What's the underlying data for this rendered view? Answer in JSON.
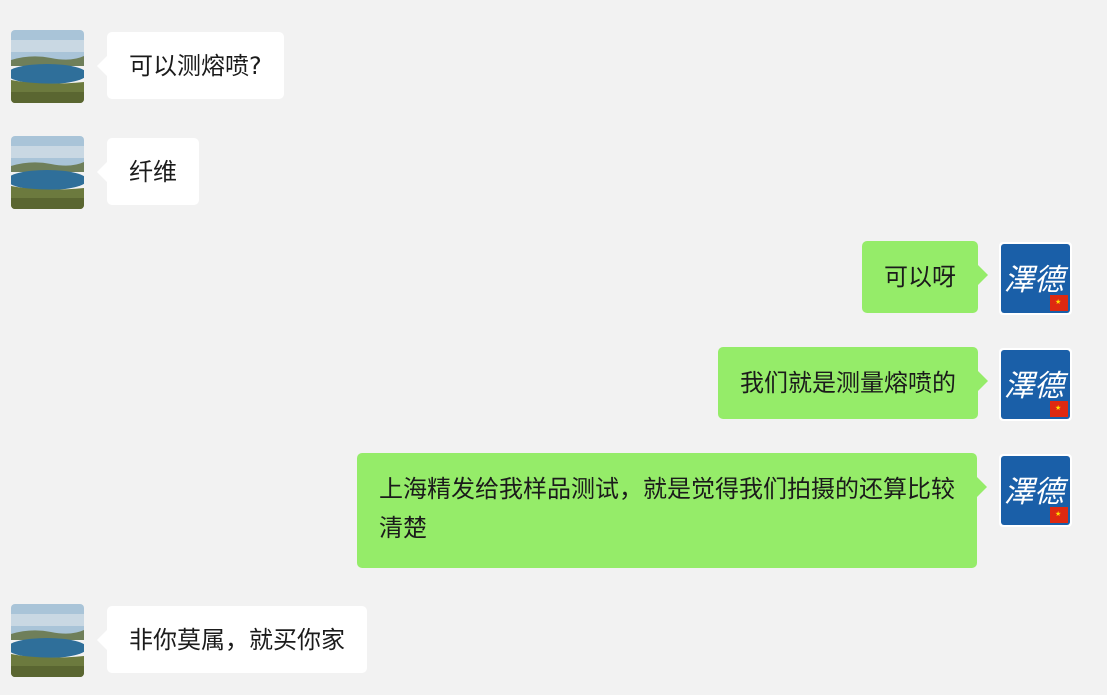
{
  "colors": {
    "background": "#f2f2f2",
    "incoming_bubble": "#ffffff",
    "outgoing_bubble": "#95ec69",
    "self_avatar_bg": "#1a5fa8"
  },
  "contact_avatar": {
    "icon": "lake-landscape-avatar"
  },
  "self_avatar": {
    "icon": "calligraphy-logo-avatar",
    "text": "澤德"
  },
  "messages": [
    {
      "sender": "contact",
      "text": "可以测熔喷?"
    },
    {
      "sender": "contact",
      "text": "纤维"
    },
    {
      "sender": "self",
      "text": "可以呀"
    },
    {
      "sender": "self",
      "text": "我们就是测量熔喷的"
    },
    {
      "sender": "self",
      "text": "上海精发给我样品测试，就是觉得我们拍摄的还算比较清楚"
    },
    {
      "sender": "contact",
      "text": "非你莫属，就买你家"
    }
  ]
}
